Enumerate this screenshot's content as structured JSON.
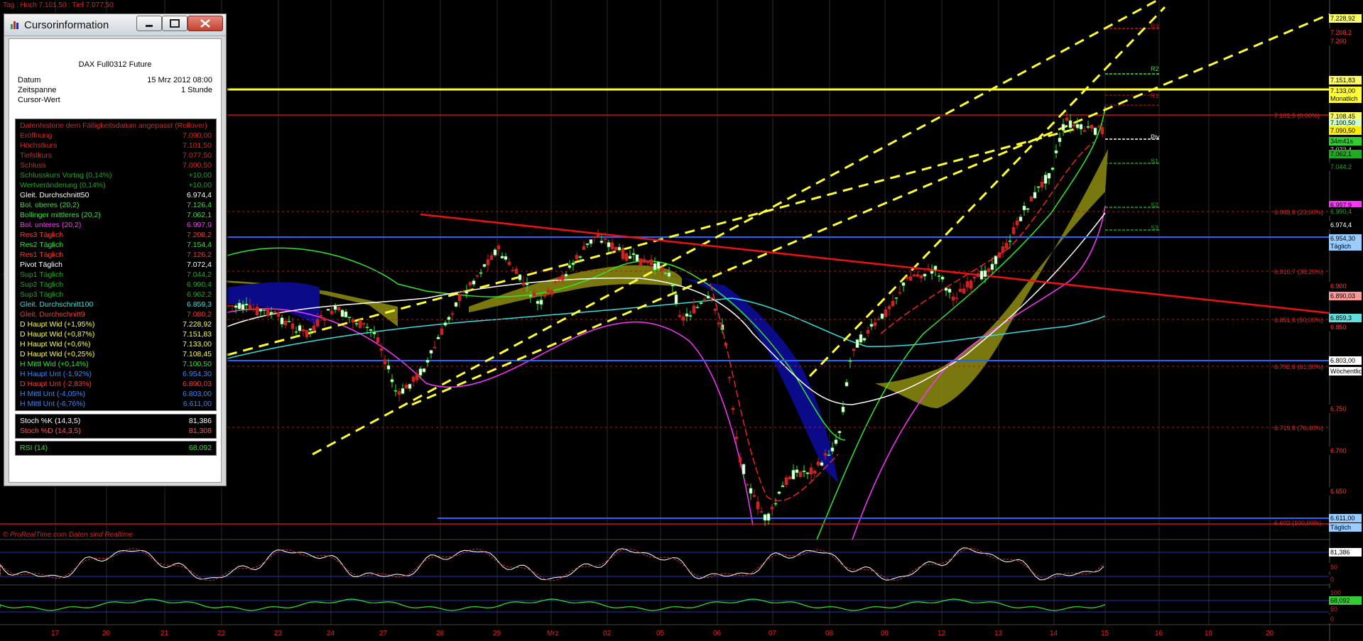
{
  "top_info": "Tag : Hoch 7.101,50 : Tief 7.077,50",
  "footer": "© ProRealTime.com  Daten sind Realtime",
  "window": {
    "title": "Cursorinformation",
    "instrument": "DAX Full0312 Future",
    "meta": [
      {
        "label": "Datum",
        "value": "15 Mrz 2012 08:00"
      },
      {
        "label": "Zeitspanne",
        "value": "1 Stunde"
      },
      {
        "label": "Cursor-Wert",
        "value": ""
      }
    ],
    "history_header": "Datenhistorie dem Fälligkeitsdatum angepasst (Rollover)",
    "rows": [
      {
        "label": "Eröffnung",
        "value": "7.090,00",
        "color": "#e02020"
      },
      {
        "label": "Höchstkurs",
        "value": "7.101,50",
        "color": "#e02020"
      },
      {
        "label": "Tiefstkurs",
        "value": "7.077,50",
        "color": "#e02020"
      },
      {
        "label": "Schluss",
        "value": "7.090,50",
        "color": "#e02020"
      },
      {
        "label": "Schlusskurs Vortag (0,14%)",
        "value": "+10,00",
        "color": "#1aa81a"
      },
      {
        "label": "Wertveränderung (0,14%)",
        "value": "+10,00",
        "color": "#1aa81a"
      },
      {
        "label": "Gleit. Durchschnitt50",
        "value": "6.974,4",
        "color": "#ffffff"
      },
      {
        "label": "Bol. oberes (20,2)",
        "value": "7.126,4",
        "color": "#2ee82e"
      },
      {
        "label": "Bollinger mittleres (20,2)",
        "value": "7.062,1",
        "color": "#2ee82e"
      },
      {
        "label": "Bol. unteres (20,2)",
        "value": "6.997,9",
        "color": "#ff33ff"
      },
      {
        "label": "Res3 Täglich",
        "value": "7.208,2",
        "color": "#ff3333"
      },
      {
        "label": "Res2 Täglich",
        "value": "7.154,4",
        "color": "#2ee82e"
      },
      {
        "label": "Res1 Täglich",
        "value": "7.126,2",
        "color": "#ff3333"
      },
      {
        "label": "Pivot Täglich",
        "value": "7.072,4",
        "color": "#ffffff"
      },
      {
        "label": "Sup1 Täglich",
        "value": "7.044,2",
        "color": "#1aa81a"
      },
      {
        "label": "Sup2 Täglich",
        "value": "6.990,4",
        "color": "#1aa81a"
      },
      {
        "label": "Sup3 Täglich",
        "value": "6.962,2",
        "color": "#1aa81a"
      },
      {
        "label": "Gleit. Durchschnitt100",
        "value": "6.859,3",
        "color": "#33e0e0"
      },
      {
        "label": "Gleit. Durchschnitt9",
        "value": "7.080,2",
        "color": "#ff3333"
      },
      {
        "label": "D Haupt Wid (+1,95%)",
        "value": "7.228,92",
        "color": "#ffff33"
      },
      {
        "label": "D Haupt Wid (+0,87%)",
        "value": "7.151,83",
        "color": "#ffff33"
      },
      {
        "label": "H Haupt Wid (+0,6%)",
        "value": "7.133,00",
        "color": "#ffff33"
      },
      {
        "label": "D Haupt Wid (+0,25%)",
        "value": "7.108,45",
        "color": "#ffff33"
      },
      {
        "label": "H Mittl Wid (+0,14%)",
        "value": "7.100,50",
        "color": "#2ee82e"
      },
      {
        "label": "H Haupt Unt (-1,92%)",
        "value": "6.954,30",
        "color": "#3388ff"
      },
      {
        "label": "D Haupt Unt (-2,83%)",
        "value": "6.890,03",
        "color": "#ff3333"
      },
      {
        "label": "H Mittl Unt (-4,05%)",
        "value": "6.803,00",
        "color": "#3388ff"
      },
      {
        "label": "H Mittl Unt (-6,76%)",
        "value": "6.611,00",
        "color": "#3388ff"
      }
    ],
    "stoch": [
      {
        "label": "Stoch %K (14,3,5)",
        "value": "81,386",
        "color": "#ffffff"
      },
      {
        "label": "Stoch %D (14,3,5)",
        "value": "81,308",
        "color": "#ff5555"
      }
    ],
    "rsi": {
      "label": "RSI (14)",
      "value": "68,092",
      "color": "#2ee82e"
    }
  },
  "price_axis": [
    {
      "label": "7.228,92",
      "bg": "#ffff66",
      "fg": "#000"
    },
    {
      "label": "7.208,2",
      "bg": "#000",
      "fg": "#ff3333"
    },
    {
      "label": "7.200",
      "bg": "#000",
      "fg": "#ff3333"
    },
    {
      "label": "7.151,83",
      "bg": "#ffff66",
      "fg": "#000"
    },
    {
      "label": "7.133,00",
      "bg": "#ffff33",
      "fg": "#000"
    },
    {
      "label": "Monatlich",
      "bg": "#ffff33",
      "fg": "#000"
    },
    {
      "label": "7.108,45",
      "bg": "#ffff66",
      "fg": "#000"
    },
    {
      "label": "7.100,50",
      "bg": "#ccffcc",
      "fg": "#000"
    },
    {
      "label": "7.090,50",
      "bg": "#ffee00",
      "fg": "#000"
    },
    {
      "label": "34m41s",
      "bg": "#33cc33",
      "fg": "#000"
    },
    {
      "label": "7.072,4",
      "bg": "#000",
      "fg": "#ddd"
    },
    {
      "label": "7.062,1",
      "bg": "#22aa22",
      "fg": "#000"
    },
    {
      "label": "7.044,2",
      "bg": "#000",
      "fg": "#1aa81a"
    },
    {
      "label": "6.997,9",
      "bg": "#ff33ff",
      "fg": "#000"
    },
    {
      "label": "6.990,4",
      "bg": "#000",
      "fg": "#1aa81a"
    },
    {
      "label": "6.974,4",
      "bg": "#000",
      "fg": "#fff"
    },
    {
      "label": "6.954,30",
      "bg": "#99ccff",
      "fg": "#000"
    },
    {
      "label": "Täglich",
      "bg": "#99ccff",
      "fg": "#000"
    },
    {
      "label": "6.900",
      "bg": "#000",
      "fg": "#ff3333"
    },
    {
      "label": "6.890,03",
      "bg": "#ff9999",
      "fg": "#000"
    },
    {
      "label": "6.859,3",
      "bg": "#66dddd",
      "fg": "#000"
    },
    {
      "label": "6.850",
      "bg": "#000",
      "fg": "#ff3333"
    },
    {
      "label": "6.803,00",
      "bg": "#ffffff",
      "fg": "#000"
    },
    {
      "label": "Wöchentlich",
      "bg": "#ffffff",
      "fg": "#000"
    },
    {
      "label": "6.750",
      "bg": "#000",
      "fg": "#ff3333"
    },
    {
      "label": "6.700",
      "bg": "#000",
      "fg": "#ff3333"
    },
    {
      "label": "6.650",
      "bg": "#000",
      "fg": "#ff3333"
    },
    {
      "label": "6.611,00",
      "bg": "#99ccff",
      "fg": "#000"
    },
    {
      "label": "Täglich",
      "bg": "#99ccff",
      "fg": "#000"
    }
  ],
  "fib_labels": [
    "7.101,5 (0,00%)",
    "6.983,8 (23,60%)",
    "6.910,7 (38,20%)",
    "6.851,8 (50,00%)",
    "6.792,8 (61,80%)",
    "6.719,8 (76,40%)",
    "6.602 (100,00%)"
  ],
  "pivot_labels": [
    "R3",
    "R2",
    "R1",
    "Piv",
    "S1",
    "S2",
    "S3"
  ],
  "dates": [
    "17",
    "20",
    "21",
    "22",
    "23",
    "24",
    "27",
    "28",
    "29",
    "Mrz",
    "02",
    "05",
    "06",
    "07",
    "08",
    "09",
    "12",
    "13",
    "14",
    "15",
    "16",
    "19",
    "20"
  ],
  "stoch_axis": [
    "81,386",
    "50",
    "0"
  ],
  "rsi_axis": [
    "100",
    "68,092",
    "50",
    "0"
  ]
}
